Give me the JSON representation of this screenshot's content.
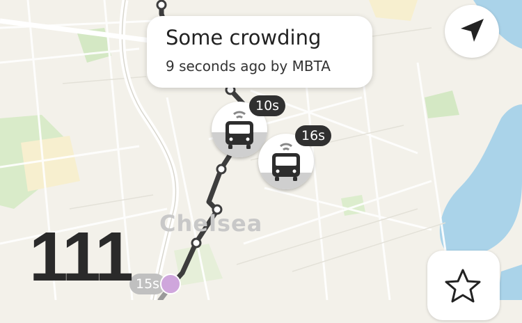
{
  "map": {
    "place_label": "Chelsea",
    "colors": {
      "land": "#f3f1ea",
      "water": "#a9d2e8",
      "park": "#d4e8c4",
      "route": "#404040",
      "road": "#ffffff"
    }
  },
  "route": {
    "number": "111"
  },
  "tooltip": {
    "title": "Some crowding",
    "subtitle": "9 seconds ago by MBTA"
  },
  "vehicles": [
    {
      "label": "10s",
      "crowding": 0.45,
      "selected": true
    },
    {
      "label": "16s",
      "crowding": 0.3,
      "selected": false
    },
    {
      "label": "15s",
      "crowding": 0,
      "selected": false,
      "faded": true
    }
  ],
  "controls": {
    "locate_icon": "location-arrow-icon",
    "favorite_icon": "star-icon"
  }
}
